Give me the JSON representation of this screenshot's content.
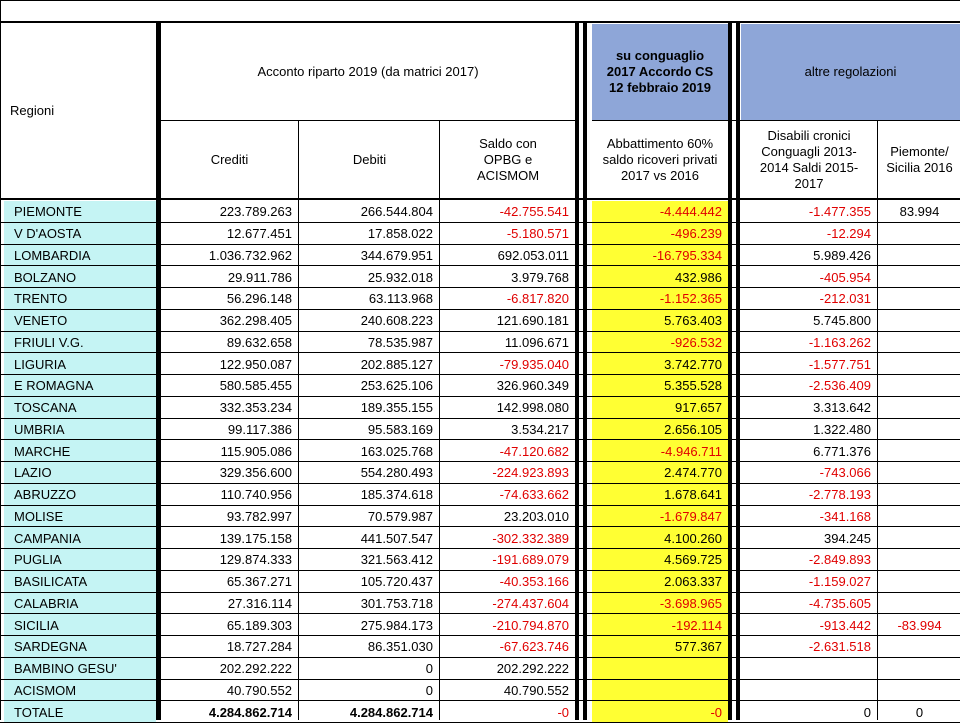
{
  "header": {
    "regioni": "Regioni",
    "acconto": "Acconto riparto 2019  (da matrici 2017)",
    "conguaglio": "su conguaglio 2017  Accordo CS 12 febbraio 2019",
    "altre": "altre regolazioni",
    "crediti": "Crediti",
    "debiti": "Debiti",
    "saldo": "Saldo con OPBG e ACISMOM",
    "abbattimento": "Abbattimento 60% saldo ricoveri privati 2017 vs 2016",
    "disabili": "Disabili cronici Conguagli 2013-2014 Saldi 2015-2017",
    "piemonte": "Piemonte/ Sicilia 2016"
  },
  "colors": {
    "region_bg": "#c5f4f4",
    "highlight": "#ffff33",
    "blue_header": "#8ea6d8",
    "negative": "#e00000"
  },
  "rows": [
    {
      "regione": "PIEMONTE",
      "crediti": "223.789.263",
      "debiti": "266.544.804",
      "saldo": "-42.755.541",
      "abbattimento": "-4.444.442",
      "disabili": "-1.477.355",
      "piemonte": "83.994"
    },
    {
      "regione": "V D'AOSTA",
      "crediti": "12.677.451",
      "debiti": "17.858.022",
      "saldo": "-5.180.571",
      "abbattimento": "-496.239",
      "disabili": "-12.294",
      "piemonte": ""
    },
    {
      "regione": "LOMBARDIA",
      "crediti": "1.036.732.962",
      "debiti": "344.679.951",
      "saldo": "692.053.011",
      "abbattimento": "-16.795.334",
      "disabili": "5.989.426",
      "piemonte": ""
    },
    {
      "regione": "BOLZANO",
      "crediti": "29.911.786",
      "debiti": "25.932.018",
      "saldo": "3.979.768",
      "abbattimento": "432.986",
      "disabili": "-405.954",
      "piemonte": ""
    },
    {
      "regione": "TRENTO",
      "crediti": "56.296.148",
      "debiti": "63.113.968",
      "saldo": "-6.817.820",
      "abbattimento": "-1.152.365",
      "disabili": "-212.031",
      "piemonte": ""
    },
    {
      "regione": "VENETO",
      "crediti": "362.298.405",
      "debiti": "240.608.223",
      "saldo": "121.690.181",
      "abbattimento": "5.763.403",
      "disabili": "5.745.800",
      "piemonte": ""
    },
    {
      "regione": "FRIULI V.G.",
      "crediti": "89.632.658",
      "debiti": "78.535.987",
      "saldo": "11.096.671",
      "abbattimento": "-926.532",
      "disabili": "-1.163.262",
      "piemonte": ""
    },
    {
      "regione": "LIGURIA",
      "crediti": "122.950.087",
      "debiti": "202.885.127",
      "saldo": "-79.935.040",
      "abbattimento": "3.742.770",
      "disabili": "-1.577.751",
      "piemonte": ""
    },
    {
      "regione": "E ROMAGNA",
      "crediti": "580.585.455",
      "debiti": "253.625.106",
      "saldo": "326.960.349",
      "abbattimento": "5.355.528",
      "disabili": "-2.536.409",
      "piemonte": ""
    },
    {
      "regione": "TOSCANA",
      "crediti": "332.353.234",
      "debiti": "189.355.155",
      "saldo": "142.998.080",
      "abbattimento": "917.657",
      "disabili": "3.313.642",
      "piemonte": ""
    },
    {
      "regione": "UMBRIA",
      "crediti": "99.117.386",
      "debiti": "95.583.169",
      "saldo": "3.534.217",
      "abbattimento": "2.656.105",
      "disabili": "1.322.480",
      "piemonte": ""
    },
    {
      "regione": "MARCHE",
      "crediti": "115.905.086",
      "debiti": "163.025.768",
      "saldo": "-47.120.682",
      "abbattimento": "-4.946.711",
      "disabili": "6.771.376",
      "piemonte": ""
    },
    {
      "regione": "LAZIO",
      "crediti": "329.356.600",
      "debiti": "554.280.493",
      "saldo": "-224.923.893",
      "abbattimento": "2.474.770",
      "disabili": "-743.066",
      "piemonte": ""
    },
    {
      "regione": "ABRUZZO",
      "crediti": "110.740.956",
      "debiti": "185.374.618",
      "saldo": "-74.633.662",
      "abbattimento": "1.678.641",
      "disabili": "-2.778.193",
      "piemonte": ""
    },
    {
      "regione": "MOLISE",
      "crediti": "93.782.997",
      "debiti": "70.579.987",
      "saldo": "23.203.010",
      "abbattimento": "-1.679.847",
      "disabili": "-341.168",
      "piemonte": ""
    },
    {
      "regione": "CAMPANIA",
      "crediti": "139.175.158",
      "debiti": "441.507.547",
      "saldo": "-302.332.389",
      "abbattimento": "4.100.260",
      "disabili": "394.245",
      "piemonte": ""
    },
    {
      "regione": "PUGLIA",
      "crediti": "129.874.333",
      "debiti": "321.563.412",
      "saldo": "-191.689.079",
      "abbattimento": "4.569.725",
      "disabili": "-2.849.893",
      "piemonte": ""
    },
    {
      "regione": "BASILICATA",
      "crediti": "65.367.271",
      "debiti": "105.720.437",
      "saldo": "-40.353.166",
      "abbattimento": "2.063.337",
      "disabili": "-1.159.027",
      "piemonte": ""
    },
    {
      "regione": "CALABRIA",
      "crediti": "27.316.114",
      "debiti": "301.753.718",
      "saldo": "-274.437.604",
      "abbattimento": "-3.698.965",
      "disabili": "-4.735.605",
      "piemonte": ""
    },
    {
      "regione": "SICILIA",
      "crediti": "65.189.303",
      "debiti": "275.984.173",
      "saldo": "-210.794.870",
      "abbattimento": "-192.114",
      "disabili": "-913.442",
      "piemonte": "-83.994"
    },
    {
      "regione": "SARDEGNA",
      "crediti": "18.727.284",
      "debiti": "86.351.030",
      "saldo": "-67.623.746",
      "abbattimento": "577.367",
      "disabili": "-2.631.518",
      "piemonte": ""
    },
    {
      "regione": "BAMBINO GESU'",
      "crediti": "202.292.222",
      "debiti": "0",
      "saldo": "202.292.222",
      "abbattimento": "",
      "disabili": "",
      "piemonte": ""
    },
    {
      "regione": "ACISMOM",
      "crediti": "40.790.552",
      "debiti": "0",
      "saldo": "40.790.552",
      "abbattimento": "",
      "disabili": "",
      "piemonte": ""
    },
    {
      "regione": "TOTALE",
      "crediti": "4.284.862.714",
      "debiti": "4.284.862.714",
      "saldo": "-0",
      "abbattimento": "-0",
      "disabili": "0",
      "piemonte": "0"
    }
  ]
}
